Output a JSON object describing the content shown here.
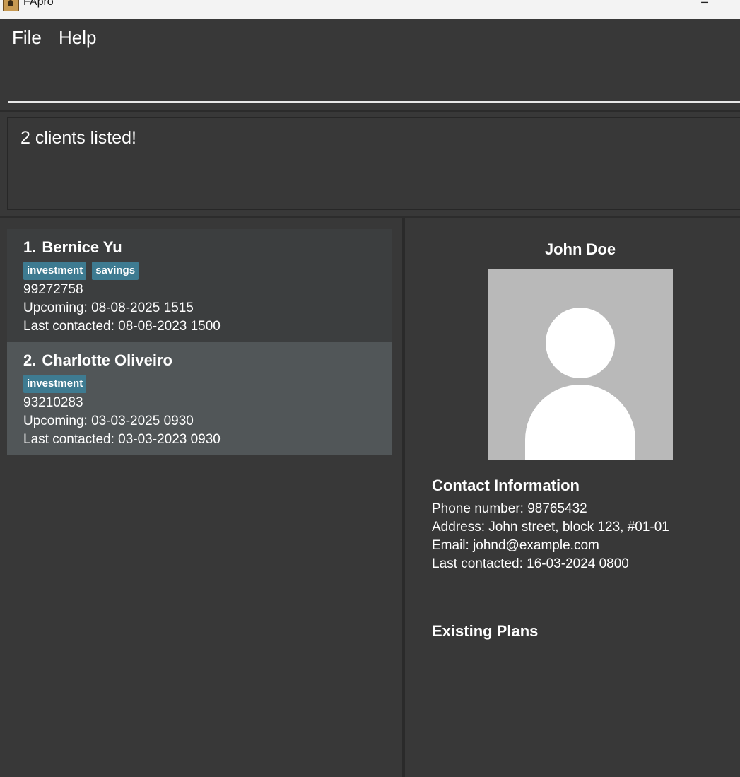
{
  "window": {
    "title": "FApro",
    "minimize_glyph": "─"
  },
  "menu": {
    "items": [
      "File",
      "Help"
    ]
  },
  "command": {
    "value": "",
    "placeholder": ""
  },
  "result": {
    "message": "2 clients listed!"
  },
  "clients": [
    {
      "index": "1.",
      "name": "Bernice Yu",
      "tags": [
        "investment",
        "savings"
      ],
      "phone": "99272758",
      "upcoming": "Upcoming: 08-08-2025 1515",
      "last_contacted": "Last contacted: 08-08-2023 1500"
    },
    {
      "index": "2.",
      "name": "Charlotte Oliveiro",
      "tags": [
        "investment"
      ],
      "phone": "93210283",
      "upcoming": "Upcoming: 03-03-2025 0930",
      "last_contacted": "Last contacted: 03-03-2023 0930"
    }
  ],
  "detail": {
    "name": "John Doe",
    "avatar_icon": "user-placeholder-icon",
    "contact_heading": "Contact Information",
    "phone": "Phone number: 98765432",
    "address": "Address: John street, block 123, #01-01",
    "email": "Email: johnd@example.com",
    "last_contacted": "Last contacted: 16-03-2024 0800",
    "plans_heading": "Existing Plans"
  },
  "colors": {
    "background": "#383838",
    "card_default": "#3c3e3f",
    "card_selected": "#515658",
    "tag": "#3e7b91",
    "avatar_bg": "#b9b9b9"
  }
}
